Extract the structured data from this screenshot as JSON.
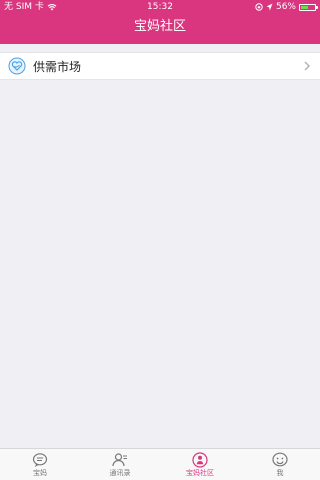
{
  "status_bar": {
    "carrier": "无 SIM 卡",
    "time": "15:32",
    "battery_text": "56%",
    "battery_level": 0.56
  },
  "nav": {
    "title": "宝妈社区"
  },
  "list": {
    "items": [
      {
        "label": "供需市场",
        "icon": "heart-handshake-icon"
      }
    ]
  },
  "tabbar": {
    "tabs": [
      {
        "label": "宝妈",
        "icon": "chat-bubble-icon",
        "active": false
      },
      {
        "label": "通讯录",
        "icon": "contacts-icon",
        "active": false
      },
      {
        "label": "宝妈社区",
        "icon": "community-icon",
        "active": true
      },
      {
        "label": "我",
        "icon": "smiley-icon",
        "active": false
      }
    ]
  },
  "colors": {
    "brand": "#d9367f",
    "background": "#efeff4",
    "battery": "#6adf4d"
  }
}
